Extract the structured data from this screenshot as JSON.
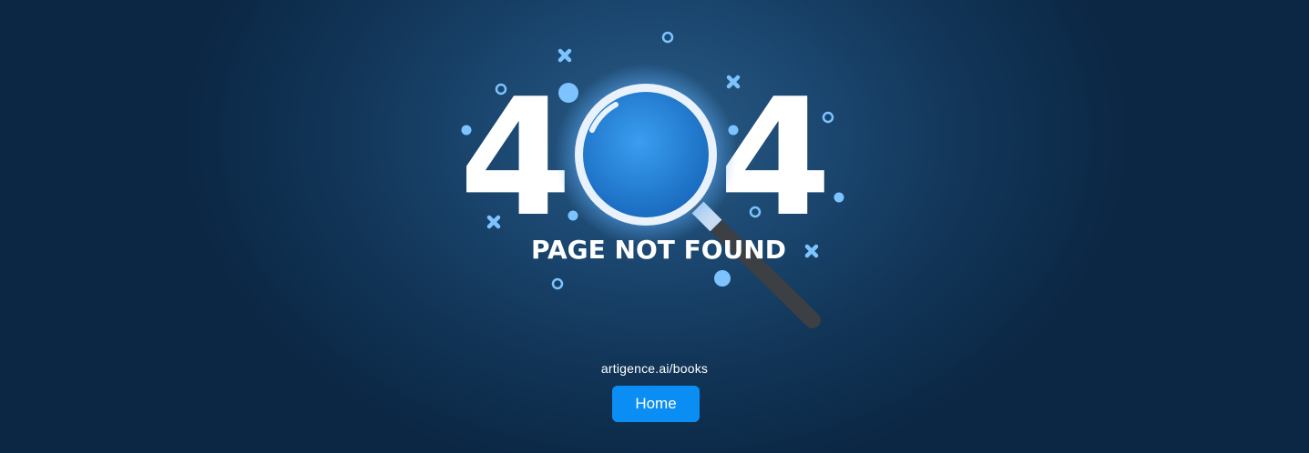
{
  "hero": {
    "digit_left": "4",
    "digit_right": "4",
    "headline": "PAGE NOT FOUND",
    "icon": "magnifying-glass-icon"
  },
  "footer": {
    "url": "artigence.ai/books",
    "home_label": "Home"
  },
  "colors": {
    "background": "#123659",
    "accent_blue": "#0b8ef3",
    "decoration": "#7cc3ff",
    "text": "#ffffff"
  }
}
